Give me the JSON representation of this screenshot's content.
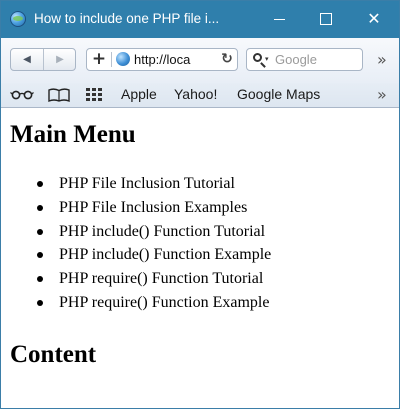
{
  "window": {
    "title": "How to include one PHP file i...",
    "minimize_glyph": "",
    "maximize_glyph": "",
    "close_glyph": "✕"
  },
  "toolbar": {
    "back_glyph": "◀",
    "forward_glyph": "▶",
    "add_glyph": "+",
    "url": "http://loca",
    "reload_glyph": "↻",
    "search_caret": "▾",
    "search_placeholder": "Google",
    "overflow_glyph": "»"
  },
  "bookmarks": {
    "items": [
      {
        "label": "Apple"
      },
      {
        "label": "Yahoo!"
      },
      {
        "label": "Google Maps"
      }
    ],
    "overflow_glyph": "»"
  },
  "page": {
    "main_heading": "Main Menu",
    "menu": [
      {
        "label": "PHP File Inclusion Tutorial"
      },
      {
        "label": "PHP File Inclusion Examples"
      },
      {
        "label": "PHP include() Function Tutorial"
      },
      {
        "label": "PHP include() Function Example"
      },
      {
        "label": "PHP require() Function Tutorial"
      },
      {
        "label": "PHP require() Function Example"
      }
    ],
    "content_heading": "Content"
  },
  "colors": {
    "titlebar": "#2f7fac",
    "toolbar": "#e8eef6",
    "bookmarks_bar": "#dde6f0",
    "page_background": "#ffffff"
  },
  "icons": {
    "app": "safari-globe-icon",
    "reading_list": "glasses-icon",
    "bookmarks": "book-icon",
    "top_sites": "grid-icon",
    "site": "globe-icon",
    "search": "search-icon"
  }
}
